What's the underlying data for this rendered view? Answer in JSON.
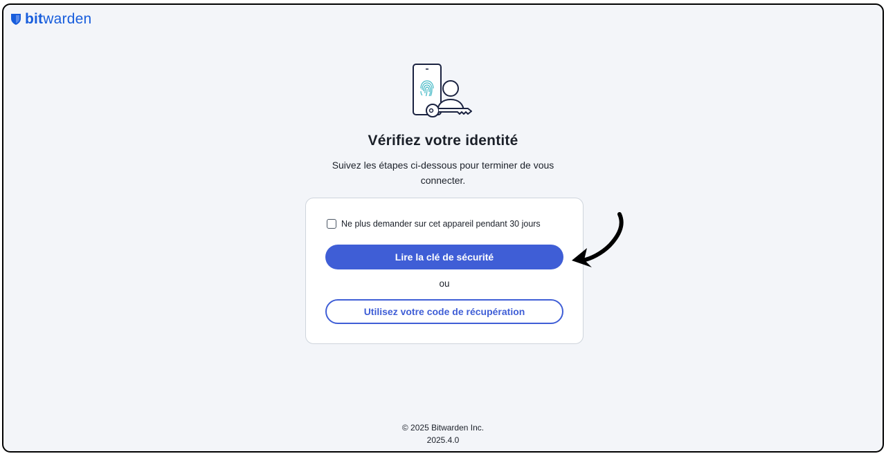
{
  "brand": {
    "name_bold": "bit",
    "name_light": "warden",
    "color": "#175ddc"
  },
  "page": {
    "title": "Vérifiez votre identité",
    "subtitle": "Suivez les étapes ci-dessous pour terminer de vous connecter.",
    "illustration": "phone-fingerprint-user-key-icon"
  },
  "form": {
    "remember_label": "Ne plus demander sur cet appareil pendant 30 jours",
    "remember_checked": false,
    "primary_button": "Lire la clé de sécurité",
    "or_text": "ou",
    "secondary_button": "Utilisez votre code de récupération",
    "accent_color": "#3f5ed6"
  },
  "annotation": {
    "icon": "curved-arrow-icon",
    "color": "#000000"
  },
  "footer": {
    "copyright": "© 2025 Bitwarden Inc.",
    "version": "2025.4.0"
  }
}
